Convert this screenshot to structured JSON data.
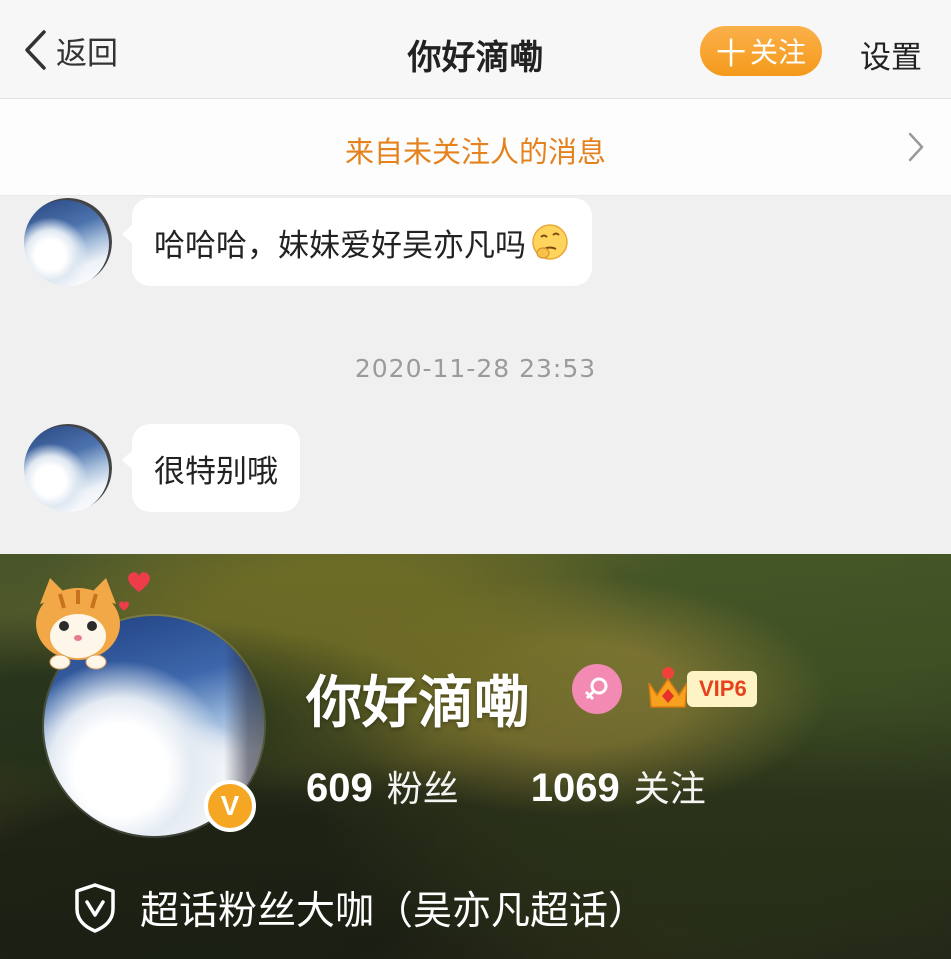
{
  "nav": {
    "back_label": "返回",
    "title": "你好滴嘞",
    "follow_label": "关注",
    "follow_plus": "十",
    "settings_label": "设置"
  },
  "notice": {
    "label": "来自未关注人的消息"
  },
  "chat": {
    "messages": [
      {
        "text": "哈哈哈，妹妹爱好吴亦凡吗",
        "emoji": "thinking-face-emoji"
      },
      {
        "text": "很特别哦"
      }
    ],
    "timestamp": "2020-11-28 23:53"
  },
  "profile": {
    "name": "你好滴嘞",
    "vip_label": "VIP6",
    "verified_mark": "V",
    "fans_count": "609",
    "fans_label": "粉丝",
    "following_count": "1069",
    "following_label": "关注",
    "badge_text": "超话粉丝大咖（吴亦凡超话）"
  },
  "colors": {
    "accent_orange": "#f49a1b",
    "notice_text": "#e5821e",
    "gender_pink": "#f28ab3",
    "vip_red": "#e6421d"
  }
}
